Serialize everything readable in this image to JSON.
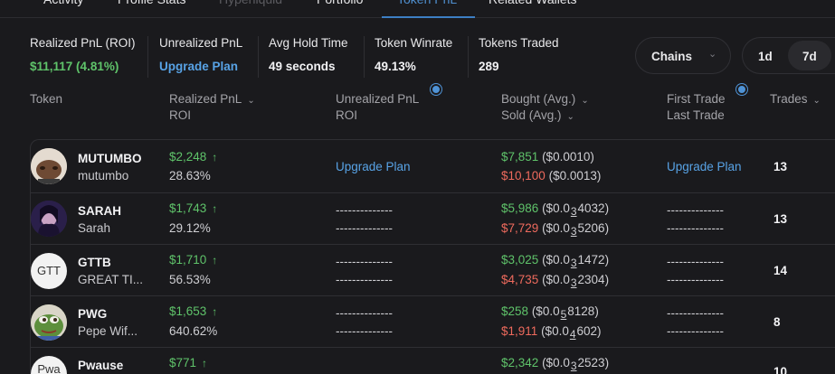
{
  "tabs": [
    {
      "label": "Activity"
    },
    {
      "label": "Profile Stats"
    },
    {
      "label": "Hyperliquid"
    },
    {
      "label": "Portfolio"
    },
    {
      "label": "Token PnL"
    },
    {
      "label": "Related Wallets"
    }
  ],
  "stats": {
    "realized": {
      "label": "Realized PnL (ROI)",
      "value": "$11,117 (4.81%)"
    },
    "unrealized": {
      "label": "Unrealized PnL",
      "value": "Upgrade Plan"
    },
    "hold": {
      "label": "Avg Hold Time",
      "value": "49 seconds"
    },
    "winrate": {
      "label": "Token Winrate",
      "value": "49.13%"
    },
    "traded": {
      "label": "Tokens Traded",
      "value": "289"
    }
  },
  "controls": {
    "chains": "Chains",
    "ranges": [
      "1d",
      "7d"
    ],
    "selected_range": "7d"
  },
  "headers": {
    "token": "Token",
    "realized": "Realized PnL",
    "realized_sub": "ROI",
    "unrealized": "Unrealized PnL",
    "unrealized_sub": "ROI",
    "bought": "Bought (Avg.)",
    "sold": "Sold (Avg.)",
    "first": "First Trade",
    "last": "Last Trade",
    "trades": "Trades"
  },
  "rows": [
    {
      "symbol": "MUTUMBO",
      "name": "mutumbo",
      "realized": "$2,248",
      "roi": "28.63%",
      "unrealized": "Upgrade Plan",
      "bought": "$7,851",
      "bought_avg": "($0.0010)",
      "sold": "$10,100",
      "sold_avg": "($0.0013)",
      "first_last": "Upgrade Plan",
      "trades": "13"
    },
    {
      "symbol": "SARAH",
      "name": "Sarah",
      "realized": "$1,743",
      "roi": "29.12%",
      "unrealized": "--------------",
      "unrealized_roi": "--------------",
      "bought": "$5,986",
      "bought_avg_pre": "($0.0",
      "bought_avg_z": "3",
      "bought_avg_post": "4032)",
      "sold": "$7,729",
      "sold_avg_pre": "($0.0",
      "sold_avg_z": "3",
      "sold_avg_post": "5206)",
      "first": "--------------",
      "last": "--------------",
      "trades": "13"
    },
    {
      "symbol": "GTTB",
      "name": "GREAT TI...",
      "avatar_text": "GTT",
      "realized": "$1,710",
      "roi": "56.53%",
      "unrealized": "--------------",
      "unrealized_roi": "--------------",
      "bought": "$3,025",
      "bought_avg_pre": "($0.0",
      "bought_avg_z": "3",
      "bought_avg_post": "1472)",
      "sold": "$4,735",
      "sold_avg_pre": "($0.0",
      "sold_avg_z": "3",
      "sold_avg_post": "2304)",
      "first": "--------------",
      "last": "--------------",
      "trades": "14"
    },
    {
      "symbol": "PWG",
      "name": "Pepe Wif...",
      "realized": "$1,653",
      "roi": "640.62%",
      "unrealized": "--------------",
      "unrealized_roi": "--------------",
      "bought": "$258",
      "bought_avg_pre": "($0.0",
      "bought_avg_z": "5",
      "bought_avg_post": "8128)",
      "sold": "$1,911",
      "sold_avg_pre": "($0.0",
      "sold_avg_z": "4",
      "sold_avg_post": "602)",
      "first": "--------------",
      "last": "--------------",
      "trades": "8"
    },
    {
      "symbol": "Pwause",
      "avatar_text": "Pwa",
      "realized": "$771",
      "bought": "$2,342",
      "bought_avg_pre": "($0.0",
      "bought_avg_z": "3",
      "bought_avg_post": "2523)",
      "trades": "10"
    }
  ],
  "colors": {
    "positive": "#5fc36a",
    "negative": "#ee6a5d",
    "link": "#58a3e6",
    "accent": "#3d7fc4"
  }
}
